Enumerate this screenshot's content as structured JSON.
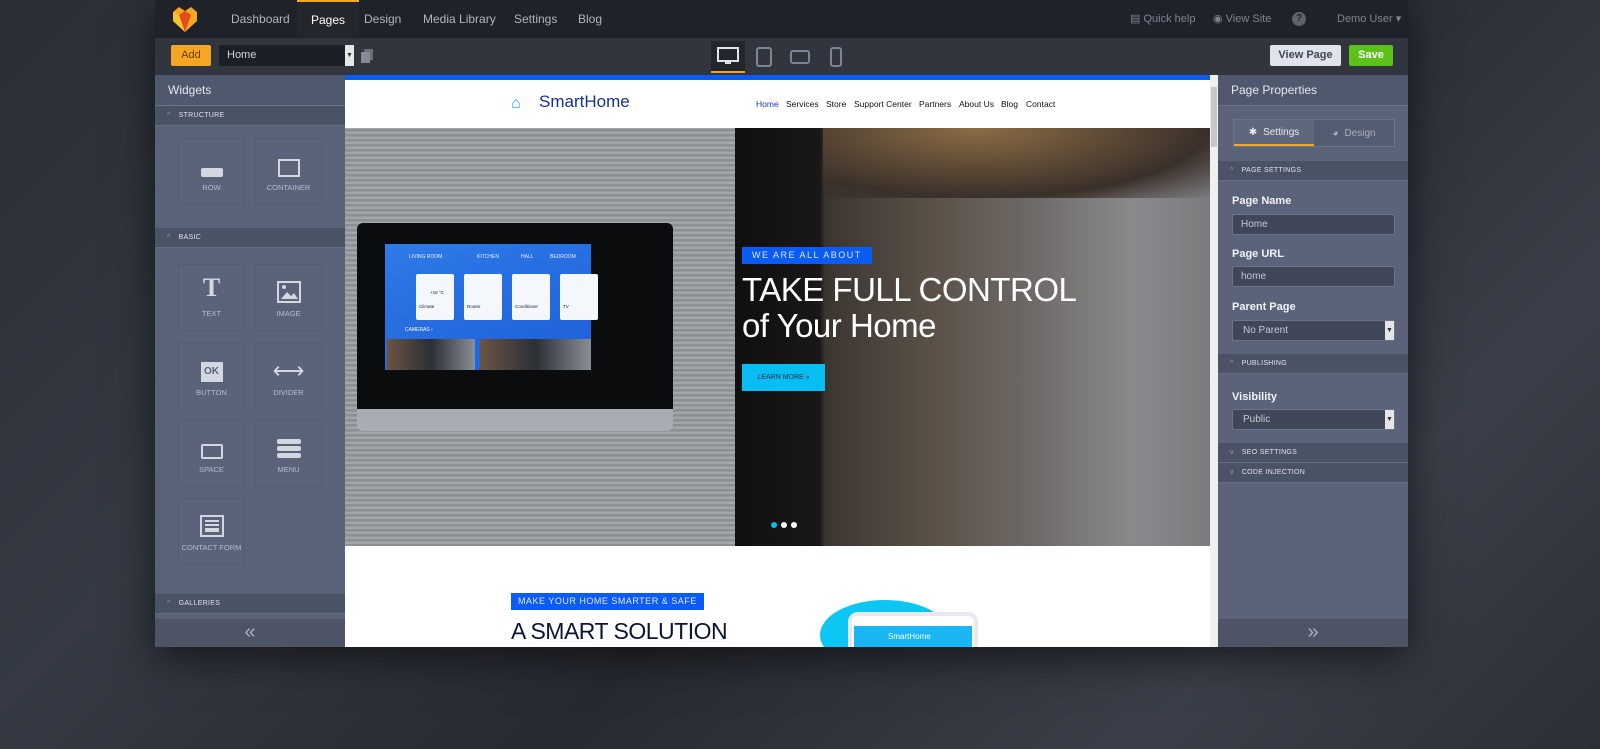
{
  "nav": {
    "items": [
      "Dashboard",
      "Pages",
      "Design",
      "Media Library",
      "Settings",
      "Blog"
    ],
    "active": "Pages",
    "quick_help": "Quick help",
    "view_site": "View Site",
    "help": "?",
    "user": "Demo User"
  },
  "toolbar": {
    "add": "Add",
    "page_select": "Home",
    "view_page": "View Page",
    "save": "Save",
    "devices": [
      "desktop",
      "tablet",
      "tablet-landscape",
      "mobile"
    ],
    "active_device": "desktop"
  },
  "widgets": {
    "title": "Widgets",
    "sections": [
      {
        "label": "STRUCTURE",
        "items": [
          "ROW",
          "CONTAINER"
        ]
      },
      {
        "label": "BASIC",
        "items": [
          "TEXT",
          "IMAGE",
          "BUTTON",
          "DIVIDER",
          "SPACE",
          "MENU",
          "CONTACT FORM"
        ]
      },
      {
        "label": "GALLERIES",
        "items": [
          "",
          ""
        ]
      }
    ],
    "ok": "OK"
  },
  "site": {
    "brand": "SmartHome",
    "nav": [
      "Home",
      "Services",
      "Store",
      "Support Center",
      "Partners",
      "About Us",
      "Blog",
      "Contact"
    ],
    "hero": {
      "badge": "WE ARE ALL ABOUT",
      "title1": "TAKE FULL CONTROL",
      "title2": "of Your Home",
      "button": "LEARN MORE  »",
      "slides": 3,
      "active_slide": 1,
      "tablet": {
        "tabs": [
          "LIVING ROOM",
          "KITCHEN",
          "HALL",
          "BEDROOM"
        ],
        "cards": [
          {
            "name": "Climate",
            "value": "+18 °C"
          },
          {
            "name": "Router"
          },
          {
            "name": "Conditioner"
          },
          {
            "name": "TV"
          }
        ],
        "cameras": "CAMERAS  ›"
      }
    },
    "section": {
      "badge": "MAKE YOUR HOME SMARTER & SAFE",
      "heading": "A SMART SOLUTION",
      "phone_text": "SmartHome"
    }
  },
  "props": {
    "title": "Page Properties",
    "tabs": [
      "Settings",
      "Design"
    ],
    "active_tab": "Settings",
    "sections": {
      "page_settings": "PAGE SETTINGS",
      "publishing": "PUBLISHING",
      "seo": "SEO SETTINGS",
      "code": "CODE INJECTION"
    },
    "page_name_label": "Page Name",
    "page_name": "Home",
    "page_url_label": "Page URL",
    "page_url": "home",
    "parent_label": "Parent Page",
    "parent": "No Parent",
    "visibility_label": "Visibility",
    "visibility": "Public"
  },
  "colors": {
    "accent": "#f5a623",
    "save": "#5cc21a",
    "site_blue": "#0a5cf5",
    "cyan": "#07bdf2"
  }
}
